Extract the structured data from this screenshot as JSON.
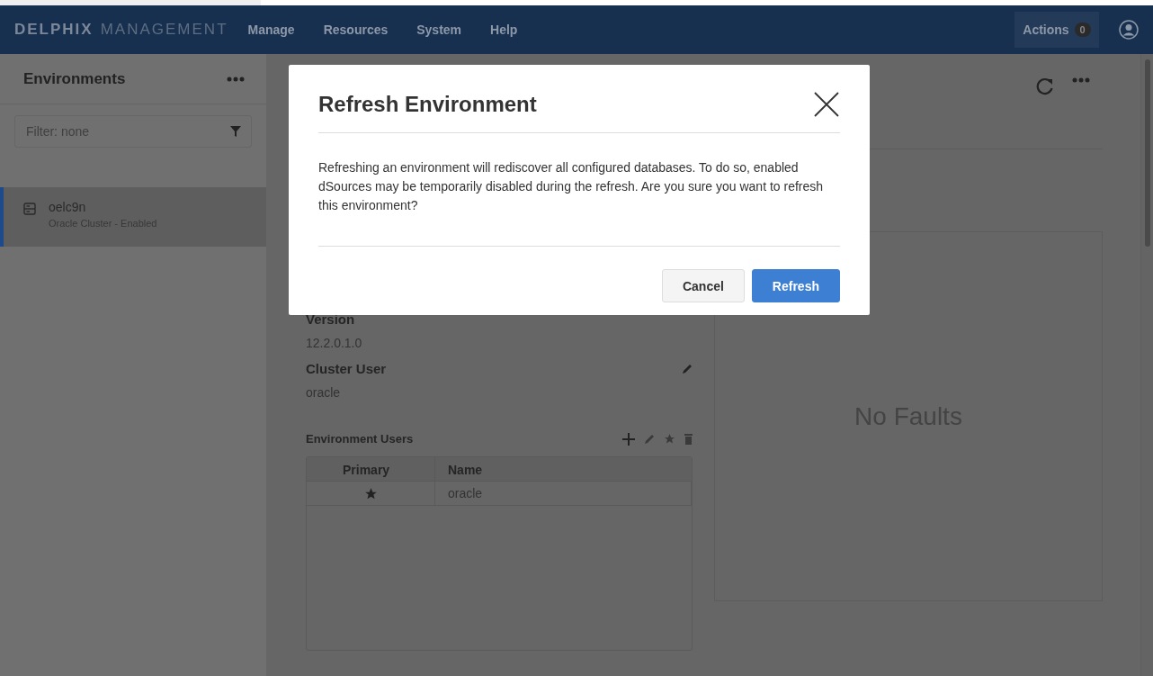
{
  "header": {
    "brand_bold": "DELPHIX",
    "brand_light": "MANAGEMENT",
    "nav": [
      "Manage",
      "Resources",
      "System",
      "Help"
    ],
    "actions": {
      "label": "Actions",
      "count": "0"
    }
  },
  "sidebar": {
    "title": "Environments",
    "filter": {
      "placeholder": "Filter: none"
    },
    "items": [
      {
        "name": "oelc9n",
        "subtitle": "Oracle Cluster - Enabled",
        "selected": true
      }
    ]
  },
  "details": {
    "fields": [
      {
        "label": "Version",
        "value": "12.2.0.1.0",
        "editable": false
      },
      {
        "label": "Cluster User",
        "value": "oracle",
        "editable": true
      }
    ],
    "users": {
      "title": "Environment Users",
      "columns": [
        "Primary",
        "Name"
      ],
      "rows": [
        {
          "primary": true,
          "name": "oracle"
        }
      ]
    }
  },
  "faults": {
    "message": "No Faults"
  },
  "dialog": {
    "title": "Refresh Environment",
    "message": "Refreshing an environment will rediscover all configured databases. To do so, enabled dSources may be temporarily disabled during the refresh. Are you sure you want to refresh this environment?",
    "buttons": [
      {
        "label": "Cancel",
        "kind": "secondary"
      },
      {
        "label": "Refresh",
        "kind": "primary"
      }
    ]
  }
}
